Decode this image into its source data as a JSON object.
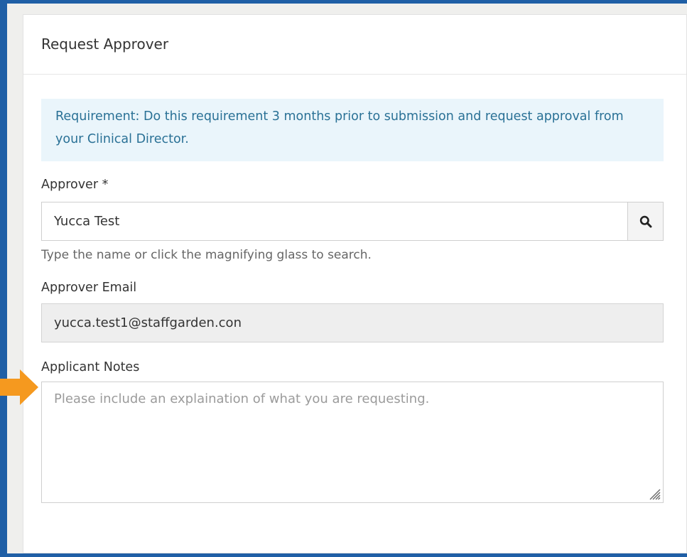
{
  "card": {
    "title": "Request Approver"
  },
  "alert": {
    "text": "Requirement: Do this requirement 3 months prior to submission and request approval from your Clinical Director."
  },
  "approver": {
    "label": "Approver *",
    "value": "Yucca Test",
    "help": "Type the name or click the magnifying glass to search.",
    "search_icon": "search-icon"
  },
  "approver_email": {
    "label": "Approver Email",
    "value": "yucca.test1@staffgarden.con"
  },
  "applicant_notes": {
    "label": "Applicant Notes",
    "placeholder": "Please include an explaination of what you are requesting."
  },
  "colors": {
    "frame_blue": "#1f5fa6",
    "alert_bg": "#eaf5fb",
    "alert_text": "#2a7196",
    "arrow": "#f5991f"
  }
}
